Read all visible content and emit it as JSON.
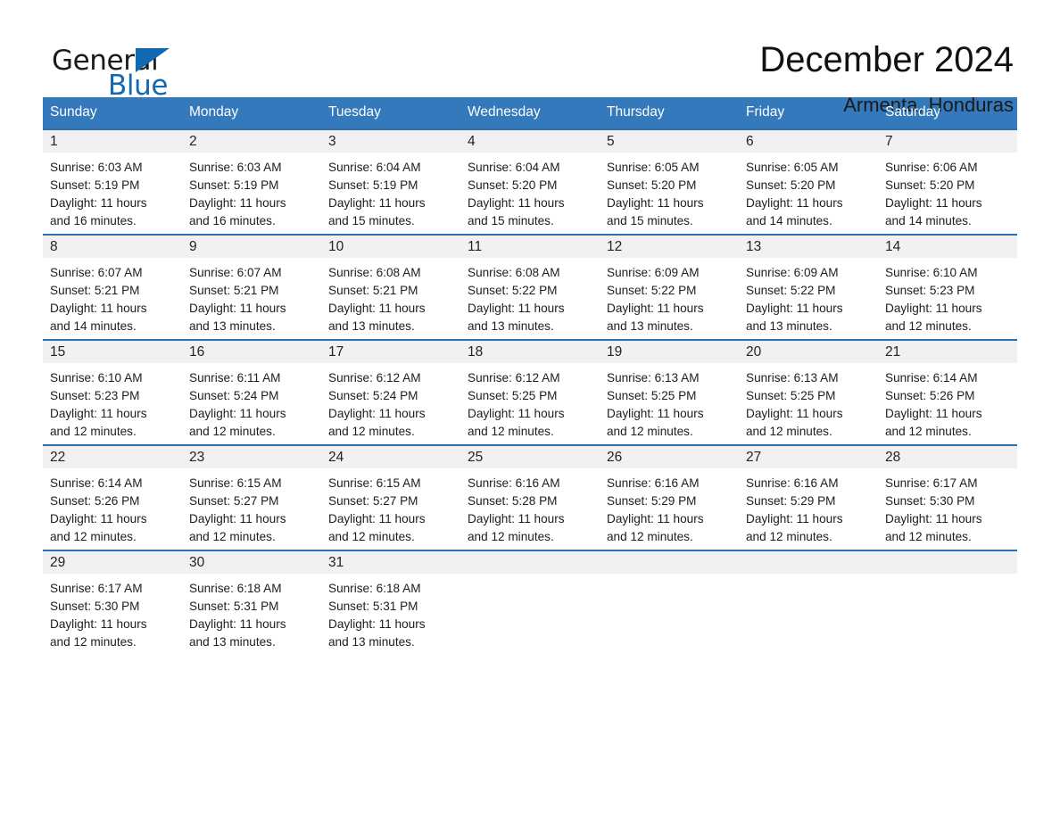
{
  "brand": {
    "word1": "General",
    "word2": "Blue",
    "triangle_color": "#1268b3"
  },
  "header": {
    "title": "December 2024",
    "subtitle": "Armenta, Honduras"
  },
  "theme": {
    "header_bg": "#3479bb",
    "row_border": "#2f6fae",
    "daynum_bg": "#f1f1f1"
  },
  "calendar": {
    "weekdays": [
      "Sunday",
      "Monday",
      "Tuesday",
      "Wednesday",
      "Thursday",
      "Friday",
      "Saturday"
    ],
    "weeks": [
      [
        {
          "day": "1",
          "sunrise": "Sunrise: 6:03 AM",
          "sunset": "Sunset: 5:19 PM",
          "daylight1": "Daylight: 11 hours",
          "daylight2": "and 16 minutes."
        },
        {
          "day": "2",
          "sunrise": "Sunrise: 6:03 AM",
          "sunset": "Sunset: 5:19 PM",
          "daylight1": "Daylight: 11 hours",
          "daylight2": "and 16 minutes."
        },
        {
          "day": "3",
          "sunrise": "Sunrise: 6:04 AM",
          "sunset": "Sunset: 5:19 PM",
          "daylight1": "Daylight: 11 hours",
          "daylight2": "and 15 minutes."
        },
        {
          "day": "4",
          "sunrise": "Sunrise: 6:04 AM",
          "sunset": "Sunset: 5:20 PM",
          "daylight1": "Daylight: 11 hours",
          "daylight2": "and 15 minutes."
        },
        {
          "day": "5",
          "sunrise": "Sunrise: 6:05 AM",
          "sunset": "Sunset: 5:20 PM",
          "daylight1": "Daylight: 11 hours",
          "daylight2": "and 15 minutes."
        },
        {
          "day": "6",
          "sunrise": "Sunrise: 6:05 AM",
          "sunset": "Sunset: 5:20 PM",
          "daylight1": "Daylight: 11 hours",
          "daylight2": "and 14 minutes."
        },
        {
          "day": "7",
          "sunrise": "Sunrise: 6:06 AM",
          "sunset": "Sunset: 5:20 PM",
          "daylight1": "Daylight: 11 hours",
          "daylight2": "and 14 minutes."
        }
      ],
      [
        {
          "day": "8",
          "sunrise": "Sunrise: 6:07 AM",
          "sunset": "Sunset: 5:21 PM",
          "daylight1": "Daylight: 11 hours",
          "daylight2": "and 14 minutes."
        },
        {
          "day": "9",
          "sunrise": "Sunrise: 6:07 AM",
          "sunset": "Sunset: 5:21 PM",
          "daylight1": "Daylight: 11 hours",
          "daylight2": "and 13 minutes."
        },
        {
          "day": "10",
          "sunrise": "Sunrise: 6:08 AM",
          "sunset": "Sunset: 5:21 PM",
          "daylight1": "Daylight: 11 hours",
          "daylight2": "and 13 minutes."
        },
        {
          "day": "11",
          "sunrise": "Sunrise: 6:08 AM",
          "sunset": "Sunset: 5:22 PM",
          "daylight1": "Daylight: 11 hours",
          "daylight2": "and 13 minutes."
        },
        {
          "day": "12",
          "sunrise": "Sunrise: 6:09 AM",
          "sunset": "Sunset: 5:22 PM",
          "daylight1": "Daylight: 11 hours",
          "daylight2": "and 13 minutes."
        },
        {
          "day": "13",
          "sunrise": "Sunrise: 6:09 AM",
          "sunset": "Sunset: 5:22 PM",
          "daylight1": "Daylight: 11 hours",
          "daylight2": "and 13 minutes."
        },
        {
          "day": "14",
          "sunrise": "Sunrise: 6:10 AM",
          "sunset": "Sunset: 5:23 PM",
          "daylight1": "Daylight: 11 hours",
          "daylight2": "and 12 minutes."
        }
      ],
      [
        {
          "day": "15",
          "sunrise": "Sunrise: 6:10 AM",
          "sunset": "Sunset: 5:23 PM",
          "daylight1": "Daylight: 11 hours",
          "daylight2": "and 12 minutes."
        },
        {
          "day": "16",
          "sunrise": "Sunrise: 6:11 AM",
          "sunset": "Sunset: 5:24 PM",
          "daylight1": "Daylight: 11 hours",
          "daylight2": "and 12 minutes."
        },
        {
          "day": "17",
          "sunrise": "Sunrise: 6:12 AM",
          "sunset": "Sunset: 5:24 PM",
          "daylight1": "Daylight: 11 hours",
          "daylight2": "and 12 minutes."
        },
        {
          "day": "18",
          "sunrise": "Sunrise: 6:12 AM",
          "sunset": "Sunset: 5:25 PM",
          "daylight1": "Daylight: 11 hours",
          "daylight2": "and 12 minutes."
        },
        {
          "day": "19",
          "sunrise": "Sunrise: 6:13 AM",
          "sunset": "Sunset: 5:25 PM",
          "daylight1": "Daylight: 11 hours",
          "daylight2": "and 12 minutes."
        },
        {
          "day": "20",
          "sunrise": "Sunrise: 6:13 AM",
          "sunset": "Sunset: 5:25 PM",
          "daylight1": "Daylight: 11 hours",
          "daylight2": "and 12 minutes."
        },
        {
          "day": "21",
          "sunrise": "Sunrise: 6:14 AM",
          "sunset": "Sunset: 5:26 PM",
          "daylight1": "Daylight: 11 hours",
          "daylight2": "and 12 minutes."
        }
      ],
      [
        {
          "day": "22",
          "sunrise": "Sunrise: 6:14 AM",
          "sunset": "Sunset: 5:26 PM",
          "daylight1": "Daylight: 11 hours",
          "daylight2": "and 12 minutes."
        },
        {
          "day": "23",
          "sunrise": "Sunrise: 6:15 AM",
          "sunset": "Sunset: 5:27 PM",
          "daylight1": "Daylight: 11 hours",
          "daylight2": "and 12 minutes."
        },
        {
          "day": "24",
          "sunrise": "Sunrise: 6:15 AM",
          "sunset": "Sunset: 5:27 PM",
          "daylight1": "Daylight: 11 hours",
          "daylight2": "and 12 minutes."
        },
        {
          "day": "25",
          "sunrise": "Sunrise: 6:16 AM",
          "sunset": "Sunset: 5:28 PM",
          "daylight1": "Daylight: 11 hours",
          "daylight2": "and 12 minutes."
        },
        {
          "day": "26",
          "sunrise": "Sunrise: 6:16 AM",
          "sunset": "Sunset: 5:29 PM",
          "daylight1": "Daylight: 11 hours",
          "daylight2": "and 12 minutes."
        },
        {
          "day": "27",
          "sunrise": "Sunrise: 6:16 AM",
          "sunset": "Sunset: 5:29 PM",
          "daylight1": "Daylight: 11 hours",
          "daylight2": "and 12 minutes."
        },
        {
          "day": "28",
          "sunrise": "Sunrise: 6:17 AM",
          "sunset": "Sunset: 5:30 PM",
          "daylight1": "Daylight: 11 hours",
          "daylight2": "and 12 minutes."
        }
      ],
      [
        {
          "day": "29",
          "sunrise": "Sunrise: 6:17 AM",
          "sunset": "Sunset: 5:30 PM",
          "daylight1": "Daylight: 11 hours",
          "daylight2": "and 12 minutes."
        },
        {
          "day": "30",
          "sunrise": "Sunrise: 6:18 AM",
          "sunset": "Sunset: 5:31 PM",
          "daylight1": "Daylight: 11 hours",
          "daylight2": "and 13 minutes."
        },
        {
          "day": "31",
          "sunrise": "Sunrise: 6:18 AM",
          "sunset": "Sunset: 5:31 PM",
          "daylight1": "Daylight: 11 hours",
          "daylight2": "and 13 minutes."
        },
        {
          "day": "",
          "sunrise": "",
          "sunset": "",
          "daylight1": "",
          "daylight2": ""
        },
        {
          "day": "",
          "sunrise": "",
          "sunset": "",
          "daylight1": "",
          "daylight2": ""
        },
        {
          "day": "",
          "sunrise": "",
          "sunset": "",
          "daylight1": "",
          "daylight2": ""
        },
        {
          "day": "",
          "sunrise": "",
          "sunset": "",
          "daylight1": "",
          "daylight2": ""
        }
      ]
    ]
  }
}
